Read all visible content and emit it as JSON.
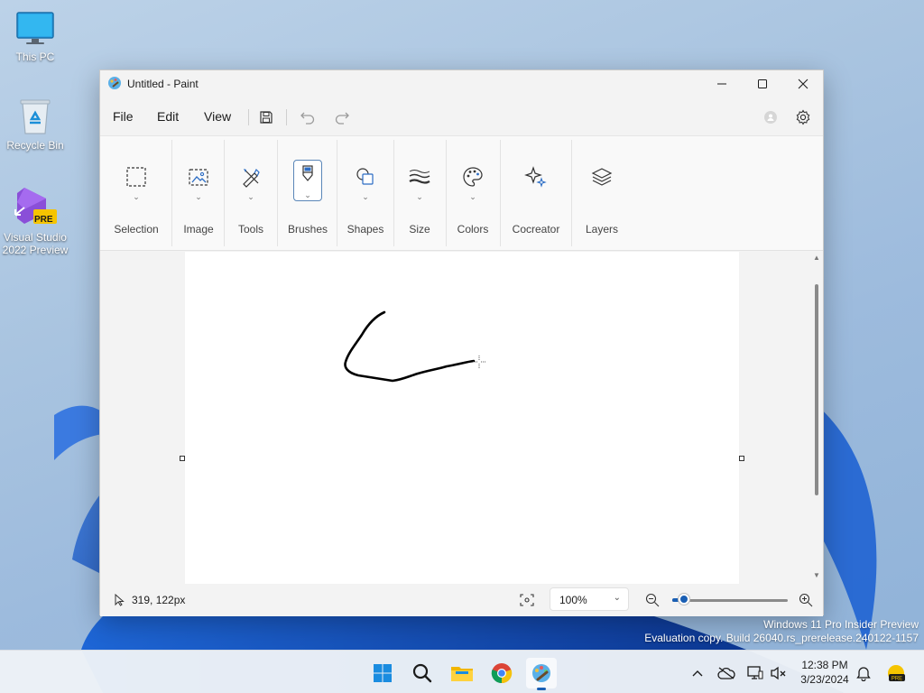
{
  "desktop": {
    "icons": [
      {
        "label": "This PC",
        "icon": "monitor-icon"
      },
      {
        "label": "Recycle Bin",
        "icon": "recycle-bin-icon"
      },
      {
        "label_line1": "Visual Studio",
        "label_line2": "2022 Preview",
        "badge": "PRE",
        "icon": "visual-studio-icon"
      }
    ],
    "watermark_line1": "Windows 11 Pro Insider Preview",
    "watermark_line2": "Evaluation copy. Build 26040.rs_prerelease.240122-1157"
  },
  "window": {
    "title": "Untitled - Paint",
    "controls": [
      "minimize-icon",
      "maximize-icon",
      "close-icon"
    ]
  },
  "menu": {
    "items": [
      "File",
      "Edit",
      "View"
    ],
    "icons": [
      "save-icon",
      "undo-icon",
      "redo-icon",
      "account-icon",
      "settings-icon"
    ]
  },
  "ribbon": {
    "groups": [
      {
        "label": "Selection",
        "icon": "selection-icon"
      },
      {
        "label": "Image",
        "icon": "image-icon"
      },
      {
        "label": "Tools",
        "icon": "tools-icon"
      },
      {
        "label": "Brushes",
        "icon": "brush-icon",
        "active": true
      },
      {
        "label": "Shapes",
        "icon": "shapes-icon"
      },
      {
        "label": "Size",
        "icon": "size-icon"
      },
      {
        "label": "Colors",
        "icon": "palette-icon"
      },
      {
        "label": "Cocreator",
        "icon": "sparkle-icon"
      },
      {
        "label": "Layers",
        "icon": "layers-icon"
      }
    ]
  },
  "status": {
    "cursor_position": "319, 122px",
    "zoom_value": "100%",
    "zoom_level": 0.1
  },
  "taskbar": {
    "apps": [
      "windows-start-icon",
      "search-icon",
      "file-explorer-icon",
      "chrome-icon",
      "paint-icon"
    ],
    "active_app": "paint-icon",
    "tray_icons": [
      "chevron-up-icon",
      "cloud-offline-icon",
      "display-icon",
      "volume-muted-icon"
    ],
    "time": "12:38 PM",
    "date": "3/23/2024"
  },
  "colors": {
    "accent": "#1a5fb4",
    "stroke": "#000000"
  }
}
